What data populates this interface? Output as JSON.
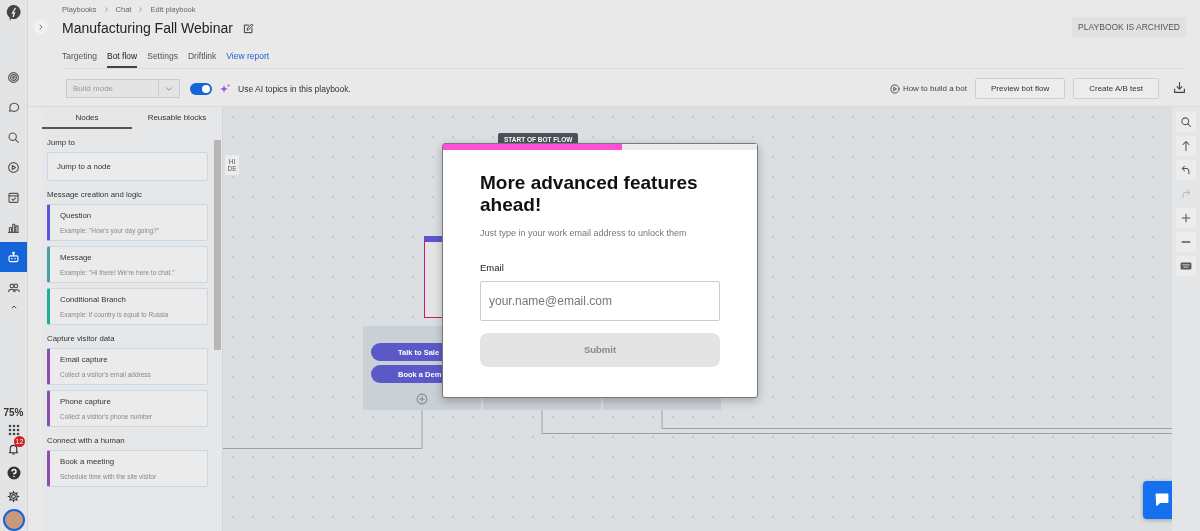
{
  "rail": {
    "items": [
      {
        "selected": false
      },
      {
        "selected": false
      },
      {
        "selected": false
      },
      {
        "selected": false
      },
      {
        "selected": false
      },
      {
        "selected": false
      },
      {
        "selected": true
      },
      {
        "selected": false
      }
    ],
    "zoom": "75%",
    "notifications": "12"
  },
  "breadcrumbs": [
    "Playbooks",
    "Chat",
    "Edit playbook"
  ],
  "title": "Manufacturing Fall Webinar",
  "status_badge": "PLAYBOOK IS ARCHIVED",
  "tabs": [
    {
      "label": "Targeting",
      "kind": "tab",
      "selected": false
    },
    {
      "label": "Bot flow",
      "kind": "tab",
      "selected": true
    },
    {
      "label": "Settings",
      "kind": "tab",
      "selected": false
    },
    {
      "label": "Driftlink",
      "kind": "tab",
      "selected": false
    },
    {
      "label": "View report",
      "kind": "link",
      "selected": false
    }
  ],
  "toolbar": {
    "mode_select": {
      "value": "Build mode",
      "disabled": true
    },
    "ai_toggle": {
      "on": true,
      "label": "Use AI topics in this playbook."
    },
    "help_link": "How to build a bot",
    "buttons": [
      "Preview bot flow",
      "Create A/B test"
    ]
  },
  "panel": {
    "tabs": [
      {
        "label": "Nodes",
        "selected": true
      },
      {
        "label": "Reusable blocks",
        "selected": false
      }
    ],
    "hide_label": "HIDE",
    "sections": [
      {
        "title": "Jump to",
        "items": [
          {
            "title": "Jump to a node"
          }
        ]
      },
      {
        "title": "Message creation and logic",
        "items": [
          {
            "title": "Question",
            "description": "Example: \"How's your day going?\"",
            "color": "#5b57d1"
          },
          {
            "title": "Message",
            "description": "Example: \"Hi there! We're here to chat.\"",
            "color": "#4a9fa5"
          },
          {
            "title": "Conditional Branch",
            "description": "Example: if country is equal to Russia",
            "color": "#1fae95"
          }
        ]
      },
      {
        "title": "Capture visitor data",
        "items": [
          {
            "title": "Email capture",
            "description": "Collect a visitor's email address",
            "color": "#8e4db5"
          },
          {
            "title": "Phone capture",
            "description": "Collect a visitor's phone number",
            "color": "#8e4db5"
          }
        ]
      },
      {
        "title": "Connect with a human",
        "items": [
          {
            "title": "Book a meeting",
            "description": "Schedule time with the site visitor",
            "color": "#8e4db5"
          }
        ]
      }
    ]
  },
  "canvas": {
    "start_label": "START OF BOT FLOW",
    "buttons": [
      "Talk to Sale",
      "Book a Dem"
    ],
    "tools": [
      {
        "disabled": false
      },
      {
        "disabled": false
      },
      {
        "disabled": false
      },
      {
        "disabled": true
      },
      {
        "disabled": false
      },
      {
        "disabled": false
      },
      {
        "disabled": false
      }
    ]
  },
  "modal": {
    "progress": {
      "level": 0.57
    },
    "heading": "More advanced features ahead!",
    "subtitle": "Just type in your work email address to unlock them",
    "email_label": "Email",
    "email_placeholder": "your.name@email.com",
    "submit": {
      "label": "Submit",
      "disabled": true
    }
  }
}
